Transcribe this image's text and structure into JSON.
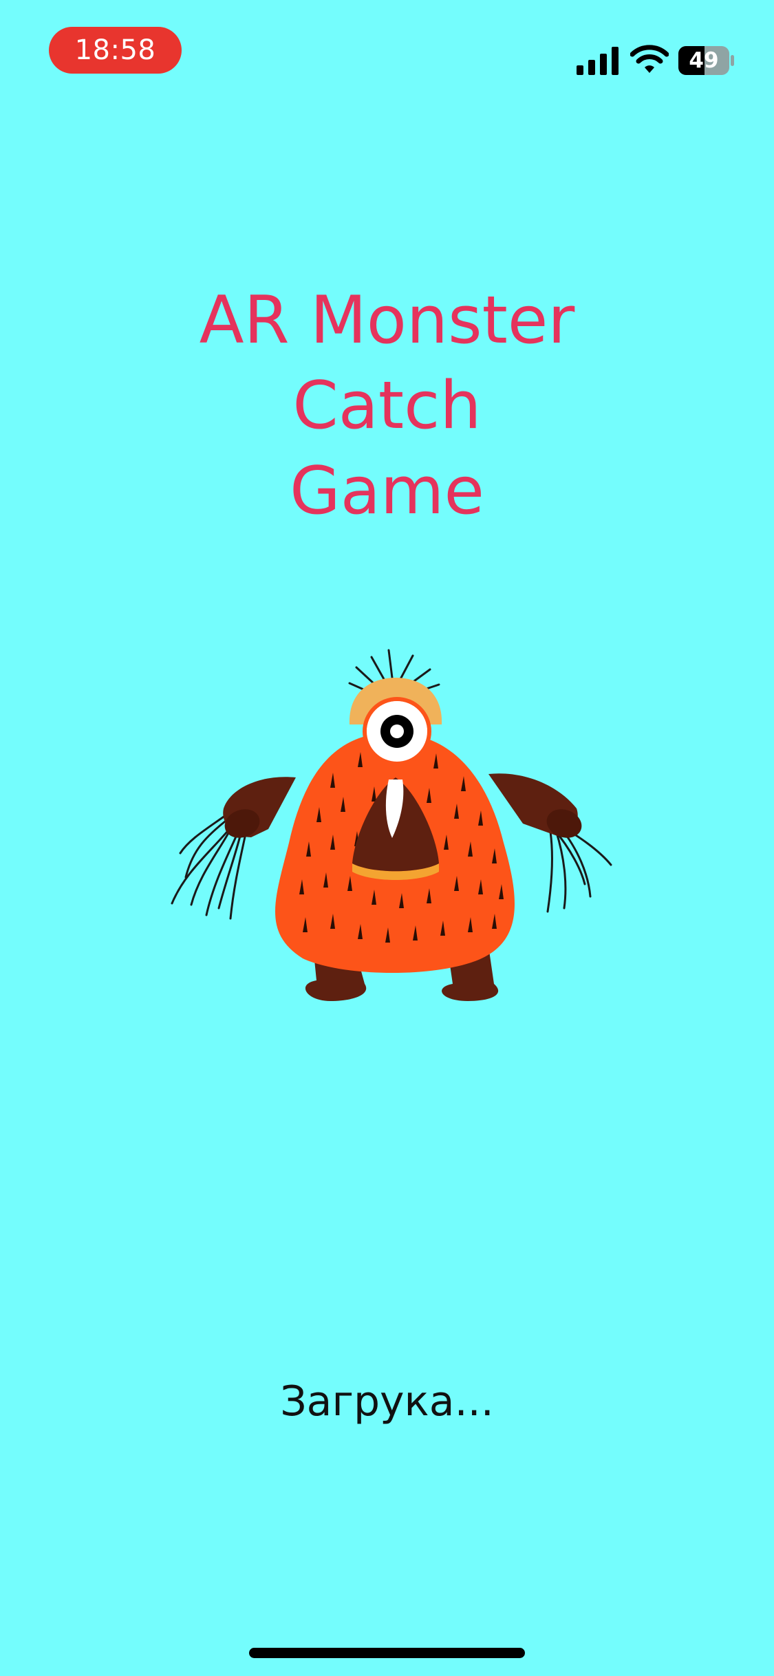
{
  "colors": {
    "background": "#74FDFD",
    "title": "#E5335C",
    "time_pill": "#E8352E",
    "monster_fur": "#FD5419",
    "monster_limbs": "#5E2010",
    "monster_hat": "#F0B25A",
    "mouth_rim": "#F4A431"
  },
  "status_bar": {
    "time": "18:58",
    "battery_level": "49",
    "icons": [
      "signal-icon",
      "wifi-icon",
      "battery-icon"
    ]
  },
  "title": {
    "line1": "AR Monster",
    "line2": "Catch",
    "line3": "Game"
  },
  "illustration": {
    "name": "one-eyed-orange-furry-monster"
  },
  "loading": {
    "text": "Загрука..."
  }
}
